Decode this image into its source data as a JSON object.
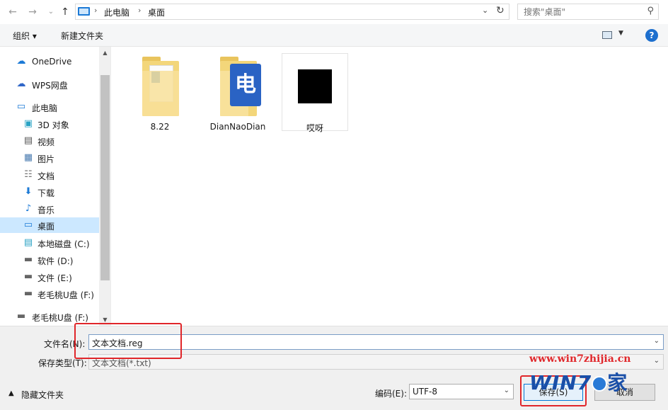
{
  "address_bar": {
    "back_icon": "back-arrow-icon",
    "forward_icon": "forward-arrow-icon",
    "history_icon": "chevron-down-icon",
    "up_icon": "up-arrow-icon",
    "path": [
      "此电脑",
      "桌面"
    ],
    "search_placeholder": "搜索\"桌面\""
  },
  "toolbar": {
    "organize_label": "组织 ▾",
    "new_folder_label": "新建文件夹"
  },
  "nav_pane": {
    "items": [
      {
        "label": "OneDrive",
        "icon": "cloud-icon"
      },
      {
        "label": "WPS网盘",
        "icon": "cloud-outline-icon"
      },
      {
        "label": "此电脑",
        "icon": "computer-icon"
      },
      {
        "label": "3D 对象",
        "icon": "cube-icon"
      },
      {
        "label": "视频",
        "icon": "film-icon"
      },
      {
        "label": "图片",
        "icon": "picture-icon"
      },
      {
        "label": "文档",
        "icon": "document-icon"
      },
      {
        "label": "下载",
        "icon": "download-icon"
      },
      {
        "label": "音乐",
        "icon": "music-icon"
      },
      {
        "label": "桌面",
        "icon": "desktop-icon",
        "selected": true
      },
      {
        "label": "本地磁盘 (C:)",
        "icon": "system-drive-icon"
      },
      {
        "label": "软件 (D:)",
        "icon": "drive-icon"
      },
      {
        "label": "文件 (E:)",
        "icon": "drive-icon"
      },
      {
        "label": "老毛桃U盘 (F:)",
        "icon": "drive-icon"
      },
      {
        "label": "老毛桃U盘 (F:)",
        "icon": "usb-drive-icon"
      }
    ]
  },
  "files": [
    {
      "name": "8.22",
      "type": "folder"
    },
    {
      "name": "DianNaoDian",
      "type": "app-folder",
      "glyph": "电"
    },
    {
      "name": "哎呀",
      "type": "image"
    }
  ],
  "form": {
    "filename_label": "文件名(N):",
    "filename_value": "文本文档.reg",
    "filetype_label": "保存类型(T):",
    "filetype_value": "文本文档(*.txt)",
    "hide_folders_label": "隐藏文件夹",
    "encoding_label": "编码(E):",
    "encoding_value": "UTF-8",
    "save_label": "保存(S)",
    "cancel_label": "取消"
  },
  "watermark": {
    "url": "www.win7zhijia.cn",
    "logo_text": "WIN7",
    "logo_suffix": "家"
  },
  "colors": {
    "accent": "#0078d7",
    "selection": "#cce8ff",
    "highlight_box": "#e0262a"
  }
}
